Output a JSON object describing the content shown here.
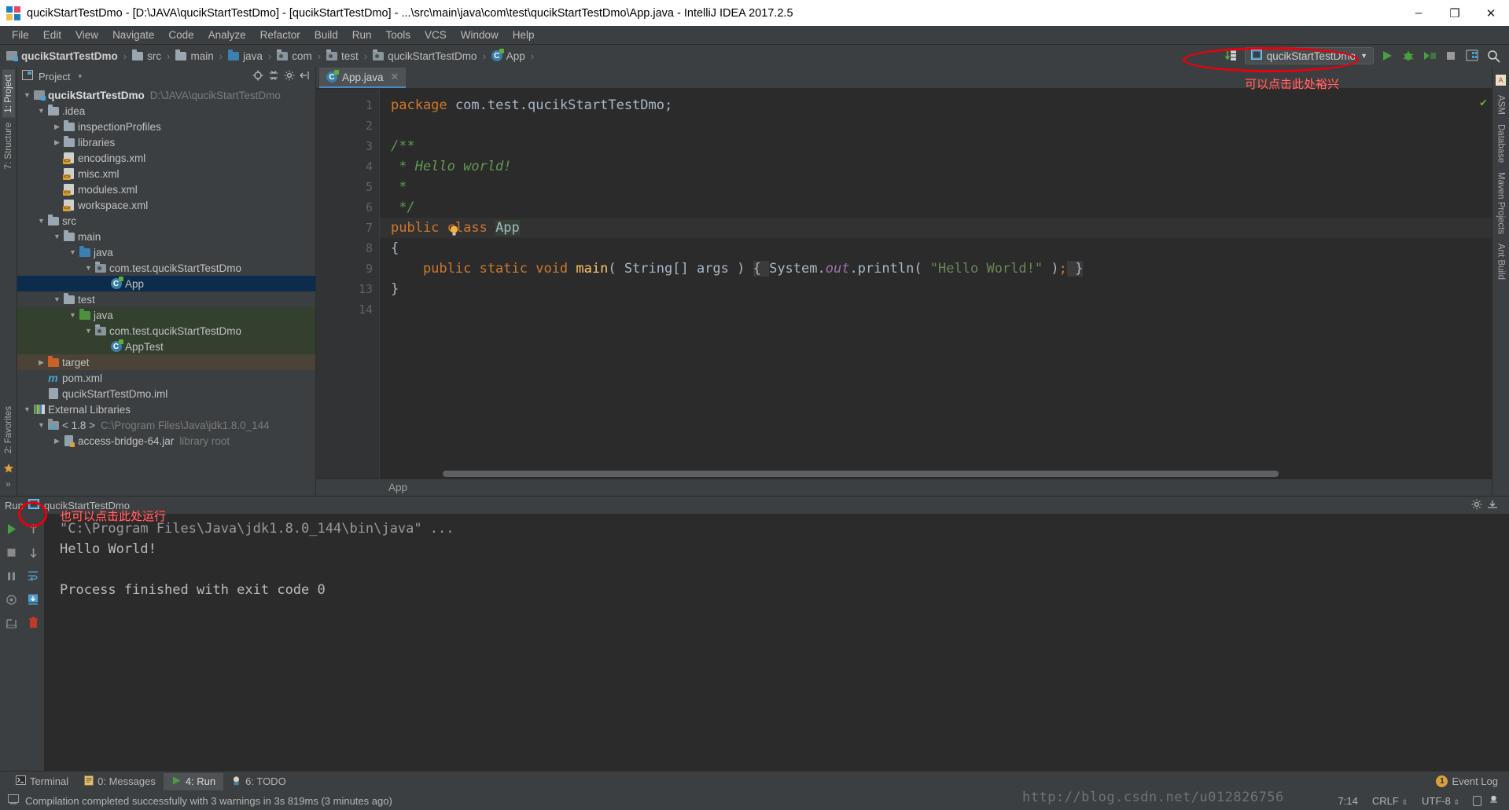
{
  "window": {
    "title": "qucikStartTestDmo - [D:\\JAVA\\qucikStartTestDmo] - [qucikStartTestDmo] - ...\\src\\main\\java\\com\\test\\qucikStartTestDmo\\App.java - IntelliJ IDEA 2017.2.5",
    "minimize": "–",
    "maximize": "❐",
    "close": "✕"
  },
  "menubar": {
    "items": [
      "File",
      "Edit",
      "View",
      "Navigate",
      "Code",
      "Analyze",
      "Refactor",
      "Build",
      "Run",
      "Tools",
      "VCS",
      "Window",
      "Help"
    ]
  },
  "breadcrumb": {
    "items": [
      {
        "label": "qucikStartTestDmo",
        "icon": "module-icon",
        "bold": true
      },
      {
        "label": "src",
        "icon": "folder-icon",
        "bold": false
      },
      {
        "label": "main",
        "icon": "folder-icon",
        "bold": false
      },
      {
        "label": "java",
        "icon": "source-folder-icon",
        "bold": false
      },
      {
        "label": "com",
        "icon": "package-icon",
        "bold": false
      },
      {
        "label": "test",
        "icon": "package-icon",
        "bold": false
      },
      {
        "label": "qucikStartTestDmo",
        "icon": "package-icon",
        "bold": false
      },
      {
        "label": "App",
        "icon": "class-icon",
        "bold": false
      }
    ],
    "separator": "›"
  },
  "toolbar": {
    "run_config_label": "qucikStartTestDmo",
    "dropdown_arrow": "▼",
    "run_button": "run-button",
    "debug_button": "debug-button",
    "run_coverage_button": "run-with-coverage-button",
    "stop_button": "stop-button",
    "project_structure_button": "project-structure-button",
    "search_button": "search-everywhere-button"
  },
  "annotations": {
    "top_note": "可以点击此处裕兴",
    "console_note": "也可以点击此处运行",
    "accent_color": "#e8000d"
  },
  "project_panel": {
    "title": "Project",
    "dropdown_arrow": "▾",
    "locate_icon": "locate-icon",
    "collapse_icon": "collapse-all-icon",
    "hide_icon": "hide-icon",
    "settings_icon": "gear-icon",
    "tree": [
      {
        "label": "qucikStartTestDmo",
        "sub": "D:\\JAVA\\qucikStartTestDmo",
        "indent": 0,
        "arrow": "▼",
        "icon": "project-icon",
        "bold": true,
        "state": ""
      },
      {
        "label": ".idea",
        "sub": "",
        "indent": 1,
        "arrow": "▼",
        "icon": "folder-icon",
        "bold": false,
        "state": ""
      },
      {
        "label": "inspectionProfiles",
        "sub": "",
        "indent": 2,
        "arrow": "▶",
        "icon": "folder-icon",
        "bold": false,
        "state": ""
      },
      {
        "label": "libraries",
        "sub": "",
        "indent": 2,
        "arrow": "▶",
        "icon": "folder-icon",
        "bold": false,
        "state": ""
      },
      {
        "label": "encodings.xml",
        "sub": "",
        "indent": 2,
        "arrow": "",
        "icon": "xml-icon",
        "bold": false,
        "state": ""
      },
      {
        "label": "misc.xml",
        "sub": "",
        "indent": 2,
        "arrow": "",
        "icon": "xml-icon",
        "bold": false,
        "state": ""
      },
      {
        "label": "modules.xml",
        "sub": "",
        "indent": 2,
        "arrow": "",
        "icon": "xml-icon",
        "bold": false,
        "state": ""
      },
      {
        "label": "workspace.xml",
        "sub": "",
        "indent": 2,
        "arrow": "",
        "icon": "xml-icon",
        "bold": false,
        "state": ""
      },
      {
        "label": "src",
        "sub": "",
        "indent": 1,
        "arrow": "▼",
        "icon": "folder-icon",
        "bold": false,
        "state": ""
      },
      {
        "label": "main",
        "sub": "",
        "indent": 2,
        "arrow": "▼",
        "icon": "folder-icon",
        "bold": false,
        "state": ""
      },
      {
        "label": "java",
        "sub": "",
        "indent": 3,
        "arrow": "▼",
        "icon": "source-folder-icon",
        "bold": false,
        "state": ""
      },
      {
        "label": "com.test.qucikStartTestDmo",
        "sub": "",
        "indent": 4,
        "arrow": "▼",
        "icon": "package-icon",
        "bold": false,
        "state": ""
      },
      {
        "label": "App",
        "sub": "",
        "indent": 5,
        "arrow": "",
        "icon": "class-icon",
        "bold": false,
        "state": "selected"
      },
      {
        "label": "test",
        "sub": "",
        "indent": 2,
        "arrow": "▼",
        "icon": "folder-icon",
        "bold": false,
        "state": ""
      },
      {
        "label": "java",
        "sub": "",
        "indent": 3,
        "arrow": "▼",
        "icon": "test-source-folder-icon",
        "bold": false,
        "state": "green"
      },
      {
        "label": "com.test.qucikStartTestDmo",
        "sub": "",
        "indent": 4,
        "arrow": "▼",
        "icon": "package-icon",
        "bold": false,
        "state": "green"
      },
      {
        "label": "AppTest",
        "sub": "",
        "indent": 5,
        "arrow": "",
        "icon": "class-icon",
        "bold": false,
        "state": "green"
      },
      {
        "label": "target",
        "sub": "",
        "indent": 1,
        "arrow": "▶",
        "icon": "excluded-folder-icon",
        "bold": false,
        "state": "brown"
      },
      {
        "label": "pom.xml",
        "sub": "",
        "indent": 1,
        "arrow": "",
        "icon": "maven-icon",
        "bold": false,
        "state": ""
      },
      {
        "label": "qucikStartTestDmo.iml",
        "sub": "",
        "indent": 1,
        "arrow": "",
        "icon": "iml-icon",
        "bold": false,
        "state": ""
      },
      {
        "label": "External Libraries",
        "sub": "",
        "indent": 0,
        "arrow": "▼",
        "icon": "library-icon",
        "bold": false,
        "state": ""
      },
      {
        "label": "< 1.8 >",
        "sub": "C:\\Program Files\\Java\\jdk1.8.0_144",
        "indent": 1,
        "arrow": "▼",
        "icon": "jdk-icon",
        "bold": false,
        "state": ""
      },
      {
        "label": "access-bridge-64.jar",
        "sub": "library root",
        "indent": 2,
        "arrow": "▶",
        "icon": "jar-icon",
        "bold": false,
        "state": ""
      }
    ]
  },
  "left_toolwindows": [
    {
      "label": "1: Project",
      "selected": true
    },
    {
      "label": "7: Structure",
      "selected": false
    },
    {
      "label": "2: Favorites",
      "selected": false
    }
  ],
  "right_toolwindows": [
    {
      "label": "ASM",
      "selected": false
    },
    {
      "label": "Database",
      "selected": false
    },
    {
      "label": "Maven Projects",
      "selected": false
    },
    {
      "label": "Ant Build",
      "selected": false
    }
  ],
  "editor": {
    "tab": {
      "label": "App.java",
      "icon": "java-class-icon",
      "close": "✕"
    },
    "footer_breadcrumb": "App",
    "inspection_status": "✔",
    "lines": [
      {
        "num": "1",
        "runmark": false,
        "fold": "",
        "highlight": false,
        "tokens": [
          {
            "t": "package",
            "c": "kw"
          },
          {
            "t": " com.test.qucikStartTestDmo;",
            "c": "punct"
          }
        ]
      },
      {
        "num": "2",
        "runmark": false,
        "fold": "",
        "highlight": false,
        "tokens": []
      },
      {
        "num": "3",
        "runmark": false,
        "fold": "minus",
        "highlight": false,
        "tokens": [
          {
            "t": "/**",
            "c": "cmt"
          }
        ]
      },
      {
        "num": "4",
        "runmark": false,
        "fold": "",
        "highlight": false,
        "tokens": [
          {
            "t": " * Hello world!",
            "c": "cmt"
          }
        ]
      },
      {
        "num": "5",
        "runmark": false,
        "fold": "",
        "highlight": false,
        "tokens": [
          {
            "t": " *",
            "c": "cmt"
          }
        ]
      },
      {
        "num": "6",
        "runmark": false,
        "fold": "minus",
        "highlight": false,
        "tokens": [
          {
            "t": " */",
            "c": "cmt"
          }
        ]
      },
      {
        "num": "7",
        "runmark": true,
        "fold": "",
        "highlight": true,
        "tokens": [
          {
            "t": "public class ",
            "c": "kw"
          },
          {
            "t": "App",
            "c": "cls-name"
          }
        ]
      },
      {
        "num": "8",
        "runmark": false,
        "fold": "",
        "highlight": false,
        "tokens": [
          {
            "t": "{",
            "c": "punct"
          }
        ]
      },
      {
        "num": "9",
        "runmark": true,
        "fold": "plus",
        "highlight": false,
        "tokens": [
          {
            "t": "    public static void ",
            "c": "kw"
          },
          {
            "t": "main",
            "c": "fn"
          },
          {
            "t": "( String[] args ) ",
            "c": "punct"
          },
          {
            "t": "{ ",
            "c": "fold-collapsed"
          },
          {
            "t": "System.",
            "c": "punct"
          },
          {
            "t": "out",
            "c": "fld"
          },
          {
            "t": ".println( ",
            "c": "punct"
          },
          {
            "t": "\"Hello World!\"",
            "c": "str"
          },
          {
            "t": " )",
            "c": "punct"
          },
          {
            "t": ";",
            "c": "kw"
          },
          {
            "t": " }",
            "c": "fold-collapsed"
          }
        ]
      },
      {
        "num": "13",
        "runmark": false,
        "fold": "",
        "highlight": false,
        "tokens": [
          {
            "t": "}",
            "c": "punct"
          }
        ]
      },
      {
        "num": "14",
        "runmark": false,
        "fold": "",
        "highlight": false,
        "tokens": []
      }
    ]
  },
  "run_panel": {
    "title": "Run",
    "config_name": "qucikStartTestDmo",
    "settings_icon": "gear-icon",
    "hide_icon": "hide-icon",
    "tool_buttons": [
      "rerun-button",
      "scroll-up-button",
      "stop-button",
      "scroll-down-button",
      "pause-button",
      "soft-wrap-button",
      "dump-threads-button",
      "scroll-to-end-button",
      "print-button",
      "clear-all-button"
    ],
    "console_lines": [
      "\"C:\\Program Files\\Java\\jdk1.8.0_144\\bin\\java\" ...",
      "Hello World!",
      "",
      "Process finished with exit code 0"
    ]
  },
  "bottom_toolwindows": [
    {
      "label": "Terminal",
      "mnemonic": "",
      "icon": "terminal-icon",
      "selected": false
    },
    {
      "label": "0: Messages",
      "mnemonic": "0",
      "icon": "messages-icon",
      "selected": false
    },
    {
      "label": "4: Run",
      "mnemonic": "4",
      "icon": "run-icon",
      "selected": true
    },
    {
      "label": "6: TODO",
      "mnemonic": "6",
      "icon": "todo-icon",
      "selected": false
    }
  ],
  "event_log": {
    "label": "Event Log",
    "count": "1"
  },
  "statusbar": {
    "message": "Compilation completed successfully with 3 warnings in 3s 819ms (3 minutes ago)",
    "caret": "7:14",
    "line_separator": "CRLF",
    "encoding": "UTF-8",
    "lock_icon": "lock-icon",
    "watermark": "http://blog.csdn.net/u012826756"
  }
}
